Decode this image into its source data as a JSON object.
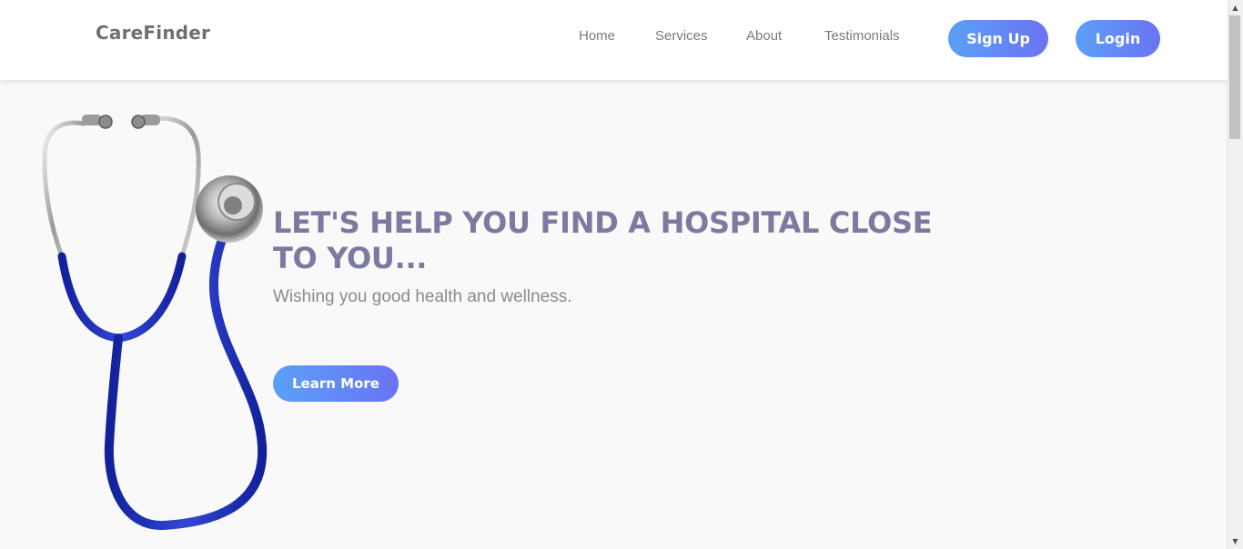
{
  "header": {
    "brand": "CareFinder",
    "nav": [
      "Home",
      "Services",
      "About",
      "Testimonials"
    ],
    "signup_label": "Sign Up",
    "login_label": "Login"
  },
  "hero": {
    "title": "LET'S HELP YOU FIND A HOSPITAL CLOSE TO YOU...",
    "subtitle": "Wishing you good health and wellness.",
    "cta_label": "Learn More",
    "illustration": "stethoscope-icon"
  },
  "colors": {
    "accent_start": "#5aa0f7",
    "accent_end": "#6b73f3",
    "title": "#7d7aa0",
    "stethoscope_tube": "#1f2fb3"
  }
}
